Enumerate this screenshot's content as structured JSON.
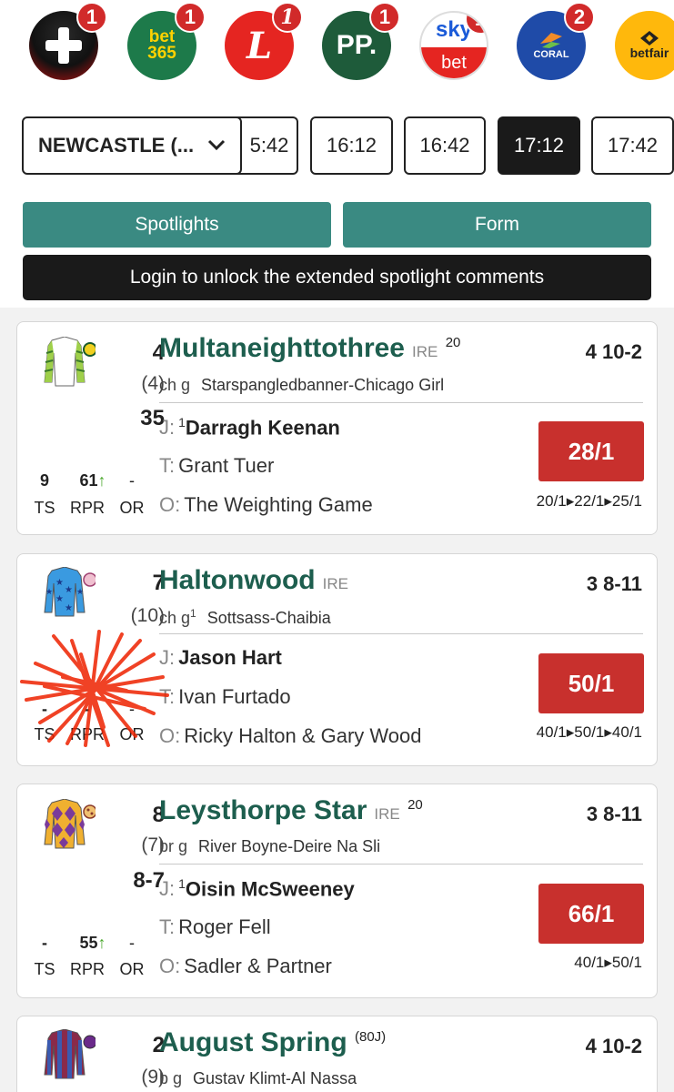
{
  "bookmakers": [
    {
      "name": "plus",
      "label": "",
      "badge": "1"
    },
    {
      "name": "bet365",
      "label_top": "bet",
      "label_bottom": "365",
      "badge": "1"
    },
    {
      "name": "ladbrokes",
      "label": "L",
      "badge": "1"
    },
    {
      "name": "paddy-power",
      "label": "PP.",
      "badge": "1"
    },
    {
      "name": "sky-bet",
      "label_top": "sky",
      "label_bottom": "bet",
      "badge": "1"
    },
    {
      "name": "coral",
      "label": "CORAL",
      "badge": "2"
    },
    {
      "name": "betfair",
      "label": "betfair",
      "badge": ""
    }
  ],
  "selector": {
    "meeting": "NEWCASTLE (...",
    "times": [
      "5:42",
      "16:12",
      "16:42",
      "17:12",
      "17:42"
    ],
    "active_time": "17:12"
  },
  "tabs": {
    "spotlights": "Spotlights",
    "form": "Form",
    "login_banner": "Login to unlock the extended spotlight comments"
  },
  "colors": {
    "accent": "#3a8a82",
    "price": "#c8302d",
    "horse_name": "#1d5e4e"
  },
  "runners": [
    {
      "number": "4",
      "draw": "(4)",
      "form": "35",
      "name": "Multaneighttothree",
      "country": "IRE",
      "days": "20",
      "age_weight": "4 10-2",
      "sex": "ch g",
      "sex_sup": "",
      "breeding": "Starspangledbanner-Chicago Girl",
      "jockey_label": "J:",
      "jockey_sup": "1",
      "jockey": "Darragh Keenan",
      "trainer_label": "T:",
      "trainer": "Grant Tuer",
      "owner_label": "O:",
      "owner": "The Weighting Game",
      "price": "28/1",
      "price_history": "20/1▸22/1▸25/1",
      "ts": "9",
      "rpr": "61",
      "or": "-",
      "rpr_arrow": "↑",
      "ts_label": "TS",
      "rpr_label": "RPR",
      "or_label": "OR"
    },
    {
      "number": "7",
      "draw": "(10)",
      "form": "",
      "name": "Haltonwood",
      "country": "IRE",
      "days": "",
      "age_weight": "3 8-11",
      "sex": "ch g",
      "sex_sup": "1",
      "breeding": "Sottsass-Chaibia",
      "jockey_label": "J:",
      "jockey_sup": "",
      "jockey": "Jason Hart",
      "trainer_label": "T:",
      "trainer": "Ivan Furtado",
      "owner_label": "O:",
      "owner": "Ricky Halton & Gary Wood",
      "price": "50/1",
      "price_history": "40/1▸50/1▸40/1",
      "ts": "-",
      "rpr": "-",
      "or": "-",
      "rpr_arrow": "",
      "ts_label": "TS",
      "rpr_label": "RPR",
      "or_label": "OR"
    },
    {
      "number": "8",
      "draw": "(7)",
      "form": "8-7",
      "name": "Leysthorpe Star",
      "country": "IRE",
      "days": "20",
      "age_weight": "3 8-11",
      "sex": "br g",
      "sex_sup": "",
      "breeding": "River Boyne-Deire Na Sli",
      "jockey_label": "J:",
      "jockey_sup": "1",
      "jockey": "Oisin McSweeney",
      "trainer_label": "T:",
      "trainer": "Roger Fell",
      "owner_label": "O:",
      "owner": "Sadler & Partner",
      "price": "66/1",
      "price_history": "40/1▸50/1",
      "ts": "-",
      "rpr": "55",
      "or": "-",
      "rpr_arrow": "↑",
      "ts_label": "TS",
      "rpr_label": "RPR",
      "or_label": "OR"
    },
    {
      "number": "2",
      "draw": "(9)",
      "form": "",
      "name": "August Spring",
      "country": "",
      "days": "(80J)",
      "age_weight": "4 10-2",
      "sex": "b g",
      "sex_sup": "",
      "breeding": "Gustav Klimt-Al Nassa"
    }
  ]
}
